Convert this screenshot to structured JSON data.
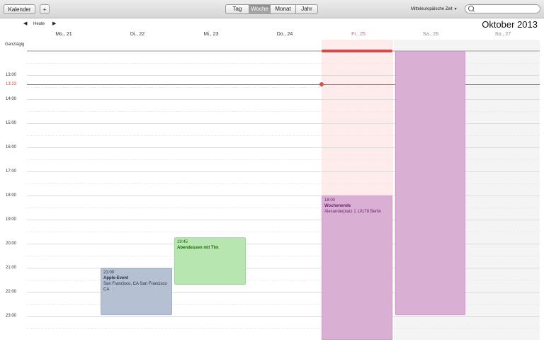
{
  "toolbar": {
    "calendars_label": "Kalender",
    "add_label": "+",
    "views": [
      "Tag",
      "Woche",
      "Monat",
      "Jahr"
    ],
    "active_view": "Woche",
    "timezone": "Mitteleuropäische Zeit",
    "search_placeholder": ""
  },
  "nav": {
    "prev": "◀",
    "today": "Heute",
    "next": "▶",
    "month_title": "Oktober 2013"
  },
  "days": [
    {
      "label": "Mo., 21"
    },
    {
      "label": "Di., 22"
    },
    {
      "label": "Mi., 23"
    },
    {
      "label": "Do., 24"
    },
    {
      "label": "Fr., 25"
    },
    {
      "label": "Sa., 26"
    },
    {
      "label": "So., 27"
    }
  ],
  "allday_label": "Ganztägig",
  "hours": [
    "13:00",
    "14:00",
    "15:00",
    "16:00",
    "17:00",
    "18:00",
    "19:00",
    "20:00",
    "21:00",
    "22:00",
    "23:00"
  ],
  "now_time": "13:23",
  "events": {
    "apple": {
      "time": "21:00",
      "title": "Apple-Event",
      "location": "San Francisco, CA San Francisco CA"
    },
    "dinner": {
      "time": "19:45",
      "title": "Abendessen mit Tim"
    },
    "weekend": {
      "time": "18:00",
      "title": "Wochenende",
      "location": "Alexanderplatz 1 10178 Berlin"
    }
  },
  "colors": {
    "today_accent": "#e25757",
    "today_bg": "#fdeceb",
    "weekend_bg": "#f4f4f4",
    "apple_event": "#b6c0d3",
    "dinner_event": "#b7e6b0",
    "weekend_event": "#d9b0d4"
  }
}
